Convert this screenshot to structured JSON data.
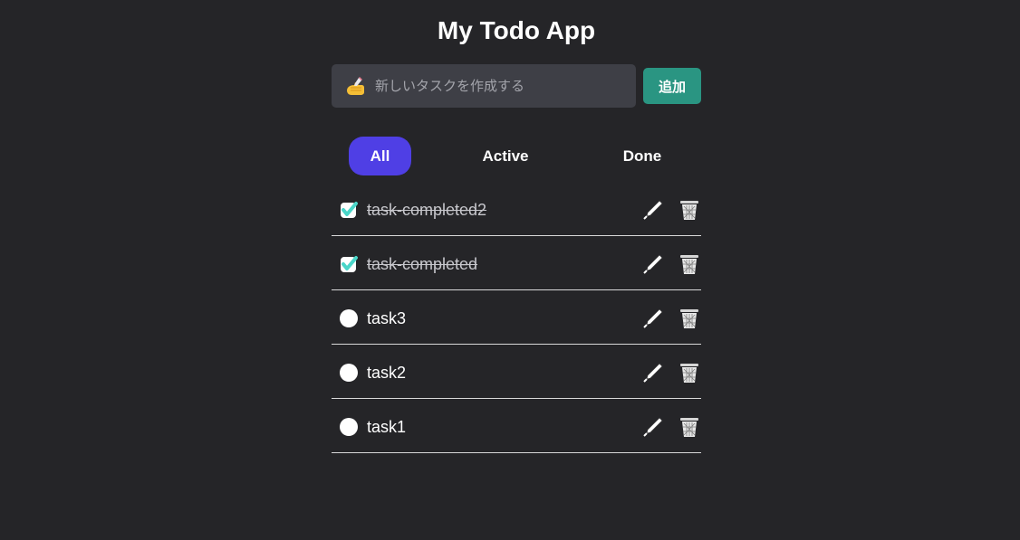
{
  "header": {
    "title": "My Todo App"
  },
  "new_task": {
    "icon": "writing-hand-icon",
    "placeholder": "新しいタスクを作成する",
    "value": "",
    "add_label": "追加"
  },
  "filters": [
    {
      "label": "All",
      "selected": true
    },
    {
      "label": "Active",
      "selected": false
    },
    {
      "label": "Done",
      "selected": false
    }
  ],
  "todos": [
    {
      "text": "task-completed2",
      "completed": true
    },
    {
      "text": "task-completed",
      "completed": true
    },
    {
      "text": "task3",
      "completed": false
    },
    {
      "text": "task2",
      "completed": false
    },
    {
      "text": "task1",
      "completed": false
    }
  ],
  "icons": {
    "completed": "check-mark-icon",
    "pending": "circle-icon",
    "edit": "pencil-icon",
    "delete": "trash-can-icon"
  },
  "colors": {
    "background": "#252528",
    "input_background": "#3e3f46",
    "add_button": "#2a9582",
    "selected_filter": "#4f3fe5",
    "check_mark": "#4ad6c9",
    "divider": "#d9d9d9"
  }
}
